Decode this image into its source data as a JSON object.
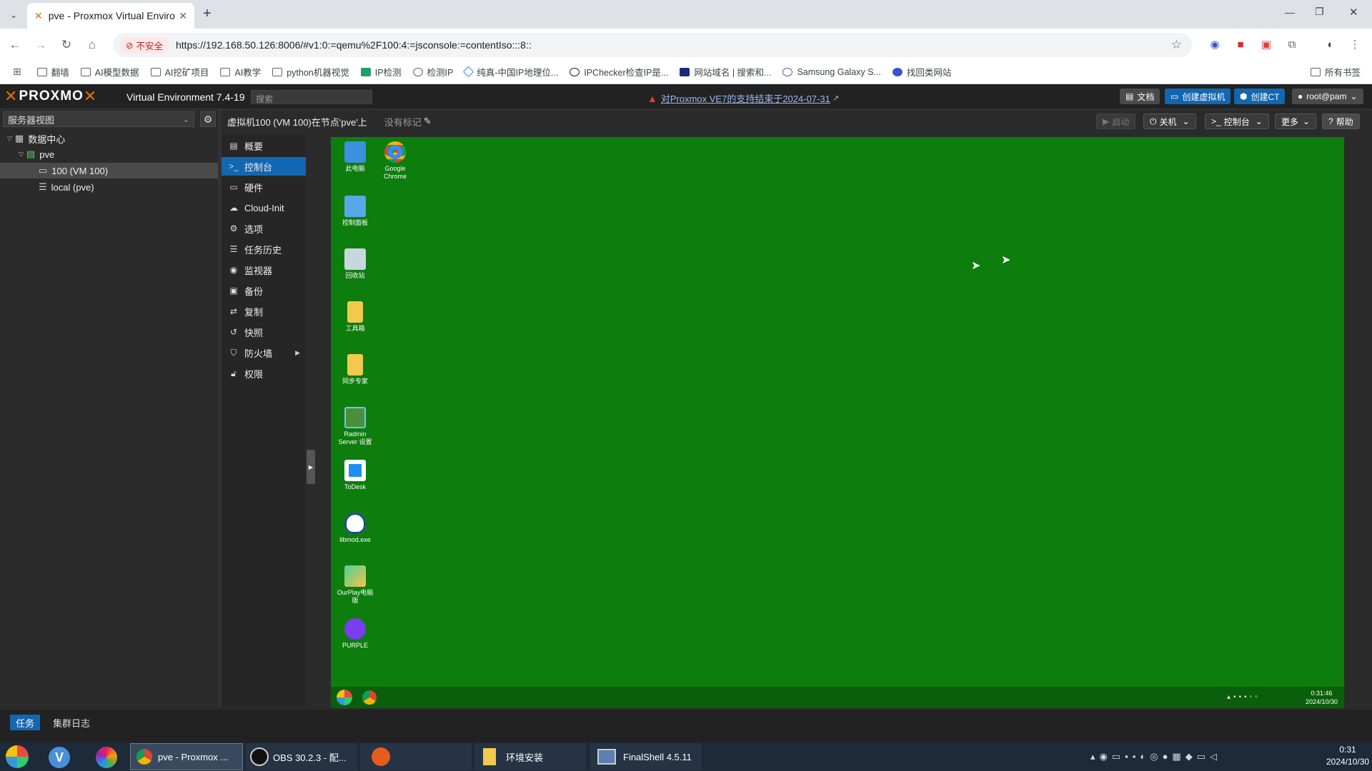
{
  "browser": {
    "tab_title": "pve - Proxmox Virtual Enviro",
    "url_security": "不安全",
    "url": "https://192.168.50.126:8006/#v1:0:=qemu%2F100:4:=jsconsole:=contentIso:::8::",
    "bookmarks": [
      "翻墙",
      "AI模型数据",
      "AI挖矿项目",
      "AI教学",
      "python机器视觉",
      "IP检测",
      "检测IP",
      "纯真-中国IP地理位...",
      "IPChecker检查IP是...",
      "网站域名 | 搜索和...",
      "Samsung Galaxy S...",
      "找回类网站"
    ],
    "all_bookmarks": "所有书签"
  },
  "pve": {
    "product": "Virtual Environment 7.4-19",
    "search_placeholder": "搜索",
    "notice": "对Proxmox VE7的支持结束于2024-07-31",
    "buttons": {
      "docs": "文档",
      "create_vm": "创建虚拟机",
      "create_ct": "创建CT",
      "user": "root@pam"
    },
    "tree_header": "服务器视图",
    "tree": {
      "datacenter": "数据中心",
      "node": "pve",
      "vm": "100 (VM 100)",
      "storage": "local (pve)"
    },
    "vm_title": "虚拟机100 (VM 100)在节点'pve'上",
    "no_tags": "没有标记",
    "actions": {
      "start": "启动",
      "shutdown": "关机",
      "console": "控制台",
      "more": "更多",
      "help": "帮助"
    },
    "menu": [
      "概要",
      "控制台",
      "硬件",
      "Cloud-Init",
      "选项",
      "任务历史",
      "监视器",
      "备份",
      "复制",
      "快照",
      "防火墙",
      "权限"
    ],
    "bottom_tabs": {
      "tasks": "任务",
      "cluster_log": "集群日志"
    }
  },
  "vm_desktop": {
    "icons": [
      "此电脑",
      "Google Chrome",
      "控制面板",
      "回收站",
      "工具箱",
      "同步专家",
      "Radmin Server 设置",
      "ToDesk",
      "libmod.exe",
      "OurPlay电脑版",
      "PURPLE"
    ],
    "clock_time": "0:31:46",
    "clock_date": "2024/10/30"
  },
  "taskbar": {
    "tasks": [
      "pve - Proxmox ...",
      "OBS 30.2.3 - 配...",
      "环境安装",
      "FinalShell 4.5.11"
    ],
    "clock_time": "0:31",
    "clock_date": "2024/10/30"
  }
}
